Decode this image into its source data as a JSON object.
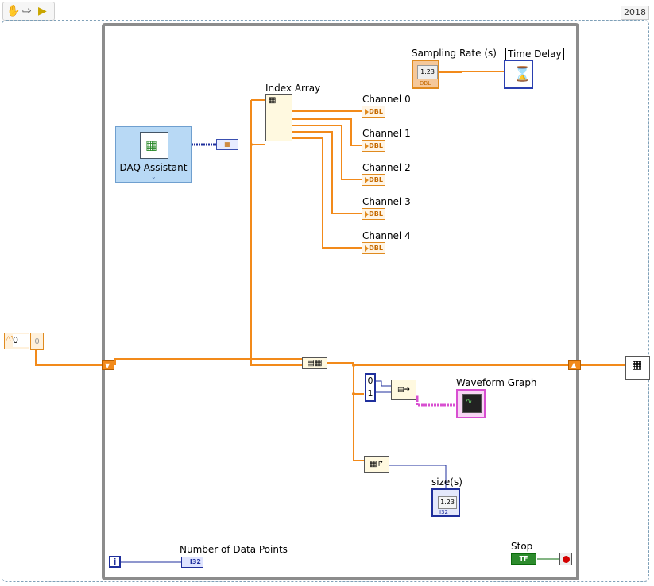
{
  "toolbar": {
    "hand_icon": "hand-icon",
    "arrow_icon": "run-arrow-icon",
    "highlight_icon": "highlight-icon"
  },
  "version_badge": "2018",
  "nodes": {
    "daq_assistant": "DAQ Assistant",
    "index_array": "Index Array",
    "sampling_rate": "Sampling Rate (s)",
    "sampling_rate_value": "1.23",
    "time_delay": "Time Delay",
    "channels": [
      "Channel 0",
      "Channel 1",
      "Channel 2",
      "Channel 3",
      "Channel 4"
    ],
    "dbl_tag": "DBL",
    "waveform_graph": "Waveform Graph",
    "size": "size(s)",
    "size_value": "1.23",
    "number_of_points": "Number of Data Points",
    "i32_tag": "I32",
    "iteration": "i",
    "stop": "Stop",
    "tf_tag": "TF",
    "const_zero": "0",
    "const_one": "1",
    "left_control_value": "0",
    "left_control_gray": "0"
  },
  "colors": {
    "orange_wire": "#f28a1a",
    "blue_wire": "#1f2f9c",
    "pink_wire": "#d84fd1",
    "loop_gray": "#8c8c8c"
  }
}
